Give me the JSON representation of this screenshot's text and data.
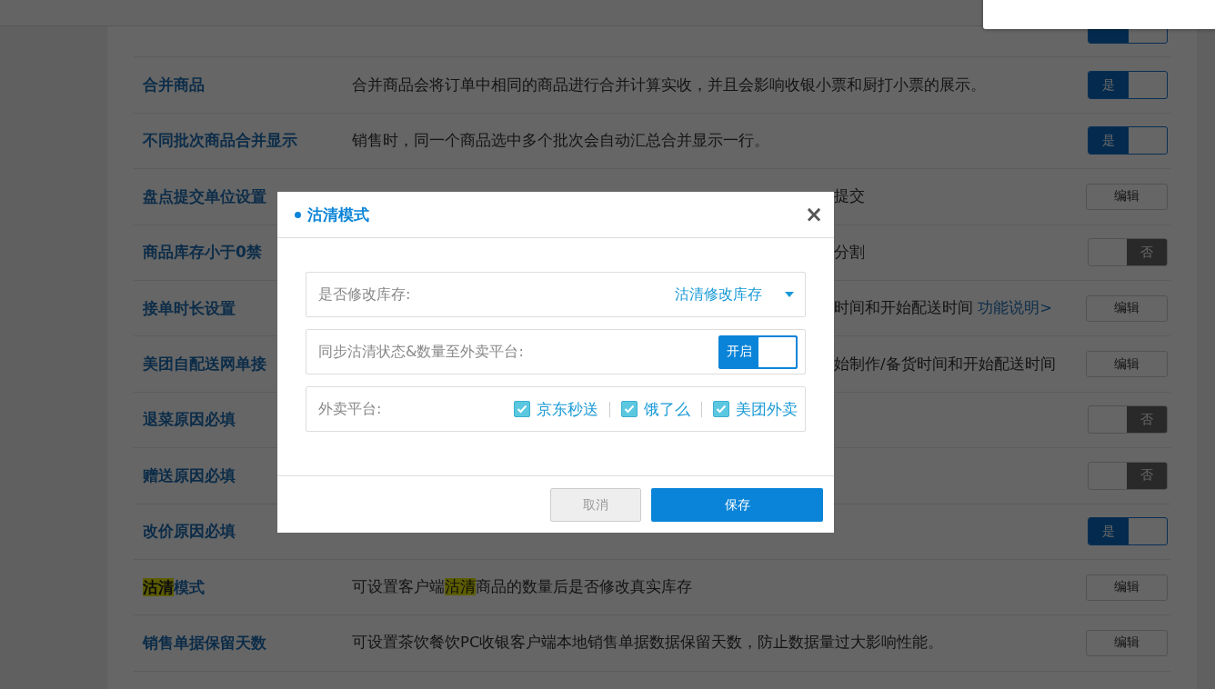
{
  "rows": [
    {
      "control": {
        "kind": "toggle",
        "on": true
      }
    },
    {
      "name": [
        {
          "text": "合并商品",
          "kind": "text"
        }
      ],
      "description": [
        {
          "text": "合并商品会将订单中相同的商品进行合并计算实收，并且会影响收银小票和厨打小票的展示。",
          "kind": "text"
        }
      ],
      "covered": false,
      "control": {
        "kind": "toggle",
        "on": true,
        "label": "是"
      }
    },
    {
      "name": [
        {
          "text": "不同批次商品合并显示",
          "kind": "text"
        }
      ],
      "description": [
        {
          "text": "销售时，同一个商品选中多个批次会自动汇总合并显示一行。",
          "kind": "text"
        }
      ],
      "covered": false,
      "control": {
        "kind": "toggle",
        "on": true,
        "label": "是"
      }
    },
    {
      "name": [
        {
          "text": "盘点提交单位设置",
          "kind": "text"
        }
      ],
      "description": [
        {
          "text": "提交",
          "kind": "text"
        }
      ],
      "covered": true,
      "control": {
        "kind": "button",
        "label": "编辑"
      }
    },
    {
      "name": [
        {
          "text": "商品库存小于0禁",
          "kind": "text"
        }
      ],
      "description": [
        {
          "text": "分割",
          "kind": "text"
        }
      ],
      "covered": true,
      "control": {
        "kind": "toggle",
        "on": false,
        "label": "否"
      }
    },
    {
      "name": [
        {
          "text": "接单时长设置",
          "kind": "text"
        }
      ],
      "description": [
        {
          "text": "时间和开始配送时间 ",
          "kind": "text"
        },
        {
          "text": "功能说明>",
          "kind": "link"
        }
      ],
      "covered": true,
      "control": {
        "kind": "button",
        "label": "编辑"
      }
    },
    {
      "name": [
        {
          "text": "美团自配送网单接",
          "kind": "text"
        }
      ],
      "description": [
        {
          "text": "始制作/备货时间和开始配送时间",
          "kind": "text"
        }
      ],
      "covered": true,
      "control": {
        "kind": "button",
        "label": "编辑"
      }
    },
    {
      "name": [
        {
          "text": "退菜原因必填",
          "kind": "text"
        }
      ],
      "control": {
        "kind": "toggle",
        "on": false,
        "label": "否"
      }
    },
    {
      "name": [
        {
          "text": "赠送原因必填",
          "kind": "text"
        }
      ],
      "control": {
        "kind": "toggle",
        "on": false,
        "label": "否"
      }
    },
    {
      "name": [
        {
          "text": "改价原因必填",
          "kind": "text"
        }
      ],
      "control": {
        "kind": "toggle",
        "on": true,
        "label": "是"
      }
    },
    {
      "name": [
        {
          "text": "沽清",
          "kind": "highlight"
        },
        {
          "text": "模式",
          "kind": "text"
        }
      ],
      "description": [
        {
          "text": "可设置客户端",
          "kind": "text"
        },
        {
          "text": "沽清",
          "kind": "highlight"
        },
        {
          "text": "商品的数量后是否修改真实库存",
          "kind": "text"
        }
      ],
      "covered": false,
      "control": {
        "kind": "button",
        "label": "编辑"
      }
    },
    {
      "name": [
        {
          "text": "销售单据保留天数",
          "kind": "text"
        }
      ],
      "description": [
        {
          "text": "可设置茶饮餐饮PC收银客户端本地销售单据数据保留天数，防止数据量过大影响性能。",
          "kind": "text"
        }
      ],
      "covered": false,
      "control": {
        "kind": "button",
        "label": "编辑"
      }
    }
  ],
  "dialog": {
    "title": "沽清模式",
    "close": "×",
    "stock": {
      "label": "是否修改库存:",
      "value": "沽清修改库存"
    },
    "sync": {
      "label": "同步沽清状态&数量至外卖平台:",
      "on": true,
      "switch_label": "开启"
    },
    "platforms_label": "外卖平台:",
    "platforms": [
      {
        "label": "京东秒送",
        "checked": true
      },
      {
        "label": "饿了么",
        "checked": true
      },
      {
        "label": "美团外卖",
        "checked": true
      }
    ],
    "buttons": [
      {
        "kind": "cancel",
        "label": "取消"
      },
      {
        "kind": "primary",
        "label": "保存"
      }
    ]
  }
}
